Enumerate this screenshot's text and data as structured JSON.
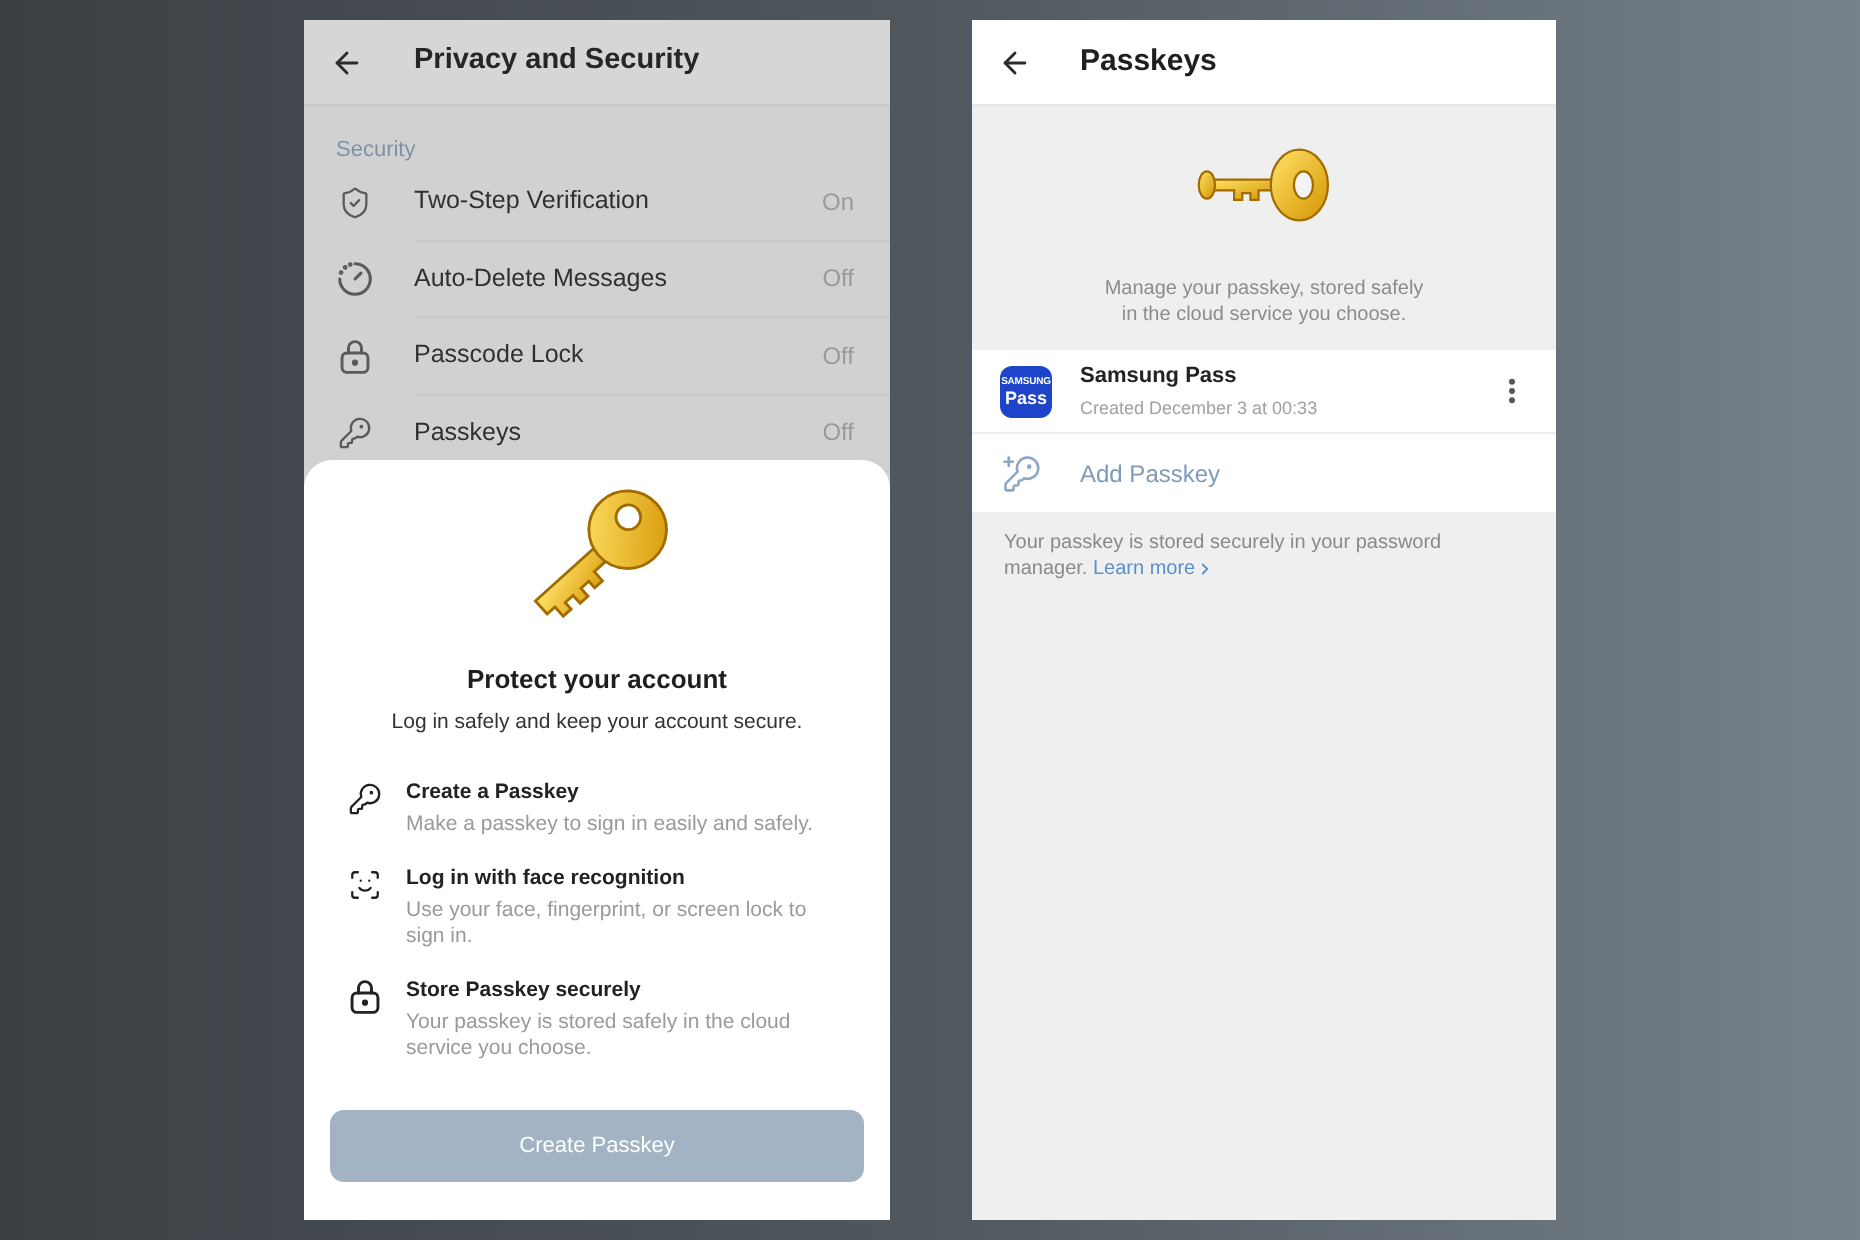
{
  "left_screen": {
    "header": {
      "title": "Privacy and Security"
    },
    "section_title": "Security",
    "settings_rows": [
      {
        "label": "Two-Step Verification",
        "value": "On"
      },
      {
        "label": "Auto-Delete Messages",
        "value": "Off"
      },
      {
        "label": "Passcode Lock",
        "value": "Off"
      },
      {
        "label": "Passkeys",
        "value": "Off"
      }
    ],
    "sheet": {
      "title": "Protect your account",
      "subtitle": "Log in safely and keep your account secure.",
      "features": [
        {
          "title": "Create a Passkey",
          "description": "Make a passkey to sign in easily and safely."
        },
        {
          "title": "Log in with face recognition",
          "description": "Use your face, fingerprint, or screen lock to sign in."
        },
        {
          "title": "Store Passkey securely",
          "description": "Your passkey is stored safely in the cloud service you choose."
        }
      ],
      "button": {
        "label": "Create Passkey",
        "disabled": true
      }
    }
  },
  "right_screen": {
    "header": {
      "title": "Passkeys"
    },
    "intro": "Manage your passkey, stored safely in the cloud service you choose.",
    "passkeys": [
      {
        "logo_brand": "SAMSUNG",
        "logo_label": "Pass",
        "name": "Samsung Pass",
        "created": "Created December 3 at 00:33"
      }
    ],
    "add_button": "Add Passkey",
    "footer": {
      "text": "Your passkey is stored securely in your password manager.",
      "link": "Learn more"
    }
  }
}
